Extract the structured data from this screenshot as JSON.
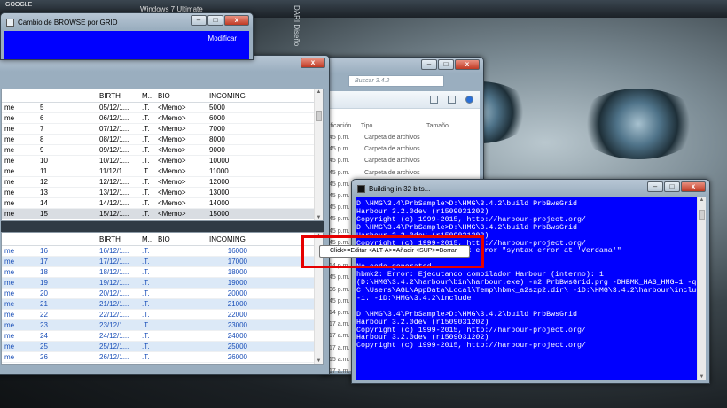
{
  "desktop": {
    "icon_label_1": "GOOGLE",
    "os_label": "Windows 7 Ultimate",
    "wallpaper_text": "DARI Diseño"
  },
  "modificar_window": {
    "title": "Cambio de BROWSE por GRID",
    "button": "Modificar",
    "controls": [
      "–",
      "□",
      "x"
    ]
  },
  "grid_window": {
    "controls": [
      "–",
      "□",
      "x"
    ],
    "columns": [
      "",
      "",
      "BIRTH",
      "M..",
      "BIO",
      "INCOMING"
    ],
    "top_rows": [
      [
        "me",
        "5",
        "05/12/1...",
        ".T.",
        "<Memo>",
        "5000"
      ],
      [
        "me",
        "6",
        "06/12/1...",
        ".T.",
        "<Memo>",
        "6000"
      ],
      [
        "me",
        "7",
        "07/12/1...",
        ".T.",
        "<Memo>",
        "7000"
      ],
      [
        "me",
        "8",
        "08/12/1...",
        ".T.",
        "<Memo>",
        "8000"
      ],
      [
        "me",
        "9",
        "09/12/1...",
        ".T.",
        "<Memo>",
        "9000"
      ],
      [
        "me",
        "10",
        "10/12/1...",
        ".T.",
        "<Memo>",
        "10000"
      ],
      [
        "me",
        "11",
        "11/12/1...",
        ".T.",
        "<Memo>",
        "11000"
      ],
      [
        "me",
        "12",
        "12/12/1...",
        ".T.",
        "<Memo>",
        "12000"
      ],
      [
        "me",
        "13",
        "13/12/1...",
        ".T.",
        "<Memo>",
        "13000"
      ],
      [
        "me",
        "14",
        "14/12/1...",
        ".T.",
        "<Memo>",
        "14000"
      ],
      [
        "me",
        "15",
        "15/12/1...",
        ".T.",
        "<Memo>",
        "15000"
      ]
    ],
    "bottom_rows": [
      [
        "me",
        "16",
        "16/12/1...",
        ".T.",
        "",
        "16000"
      ],
      [
        "me",
        "17",
        "17/12/1...",
        ".T.",
        "",
        "17000"
      ],
      [
        "me",
        "18",
        "18/12/1...",
        ".T.",
        "",
        "18000"
      ],
      [
        "me",
        "19",
        "19/12/1...",
        ".T.",
        "",
        "19000"
      ],
      [
        "me",
        "20",
        "20/12/1...",
        ".T.",
        "",
        "20000"
      ],
      [
        "me",
        "21",
        "21/12/1...",
        ".T.",
        "",
        "21000"
      ],
      [
        "me",
        "22",
        "22/12/1...",
        ".T.",
        "",
        "22000"
      ],
      [
        "me",
        "23",
        "23/12/1...",
        ".T.",
        "",
        "23000"
      ],
      [
        "me",
        "24",
        "24/12/1...",
        ".T.",
        "",
        "24000"
      ],
      [
        "me",
        "25",
        "25/12/1...",
        ".T.",
        "",
        "25000"
      ],
      [
        "me",
        "26",
        "26/12/1...",
        ".T.",
        "",
        "26000"
      ]
    ]
  },
  "explorer": {
    "search_placeholder": "Buscar 3.4.2",
    "col_date": "ificación",
    "col_type": "Tipo",
    "col_size": "Tamaño",
    "rows": [
      [
        "45 p.m.",
        "Carpeta de archivos"
      ],
      [
        "45 p.m.",
        "Carpeta de archivos"
      ],
      [
        "45 p.m.",
        "Carpeta de archivos"
      ],
      [
        "45 p.m.",
        "Carpeta de archivos"
      ],
      [
        "45 p.m.",
        "Carpeta de archivos"
      ],
      [
        "45 p.m.",
        ""
      ],
      [
        "45 p.m.",
        ""
      ],
      [
        "45 p.m.",
        ""
      ],
      [
        "45 p.m.",
        ""
      ],
      [
        "45 p.m.",
        ""
      ],
      [
        "45 p.m.",
        ""
      ],
      [
        "14 p.m.",
        ""
      ],
      [
        "45 p.m.",
        ""
      ],
      [
        "06 p.m.",
        ""
      ],
      [
        "45 p.m.",
        ""
      ],
      [
        "14 p.m.",
        ""
      ],
      [
        "17 a.m.",
        ""
      ],
      [
        "17 a.m.",
        ""
      ],
      [
        "17 a.m.",
        ""
      ],
      [
        "15 a.m.",
        ""
      ],
      [
        "17 a.m.",
        ""
      ]
    ]
  },
  "console": {
    "title": "Building in 32 bits...",
    "controls": [
      "–",
      "□",
      "x"
    ],
    "lines": [
      "D:\\HMG\\3.4\\PrbSample>D:\\HMG\\3.4.2\\build PrbBwsGrid",
      "Harbour 3.2.0dev (r1509031202)",
      "Copyright (c) 1999-2015, http://harbour-project.org/",
      "D:\\HMG\\3.4\\PrbSample>D:\\HMG\\3.4.2\\build PrbBwsGrid",
      "Harbour 3.2.0dev (r1509031202)",
      "Copyright (c) 1999-2015, http://harbour-project.org/",
      "PrbBwsGrid.prg(130) Syntax error \"syntax error at 'Verdana'\"",
      "",
      "No code generated.",
      "hbmk2: Error: Ejecutando compilador Harbour (interno): 1",
      "(D:\\HMG\\3.4.2\\harbour\\bin\\harbour.exe) -n2 PrbBwsGrid.prg -DHBMK_HAS_HMG=1 -q -o",
      "C:\\Users\\AGL\\AppData\\Local\\Temp\\hbmk_a2szp2.dir\\ -iD:\\HMG\\3.4.2\\harbour\\include",
      "-i. -iD:\\HMG\\3.4.2\\include",
      "",
      "D:\\HMG\\3.4\\PrbSample>D:\\HMG\\3.4.2\\build PrbBwsGrid",
      "Harbour 3.2.0dev (r1509031202)",
      "Copyright (c) 1999-2015, http://harbour-project.org/",
      "Harbour 3.2.0dev (r1509031202)",
      "Copyright (c) 1999-2015, http://harbour-project.org/"
    ]
  },
  "tooltip": {
    "text": "Click>=Editar  <ALT-A>=Añadir  <SUP>=Borrar"
  },
  "colors": {
    "console_bg": "#0000ff",
    "highlight": "#e60000",
    "grid_alt_row": "#dce9f7"
  }
}
